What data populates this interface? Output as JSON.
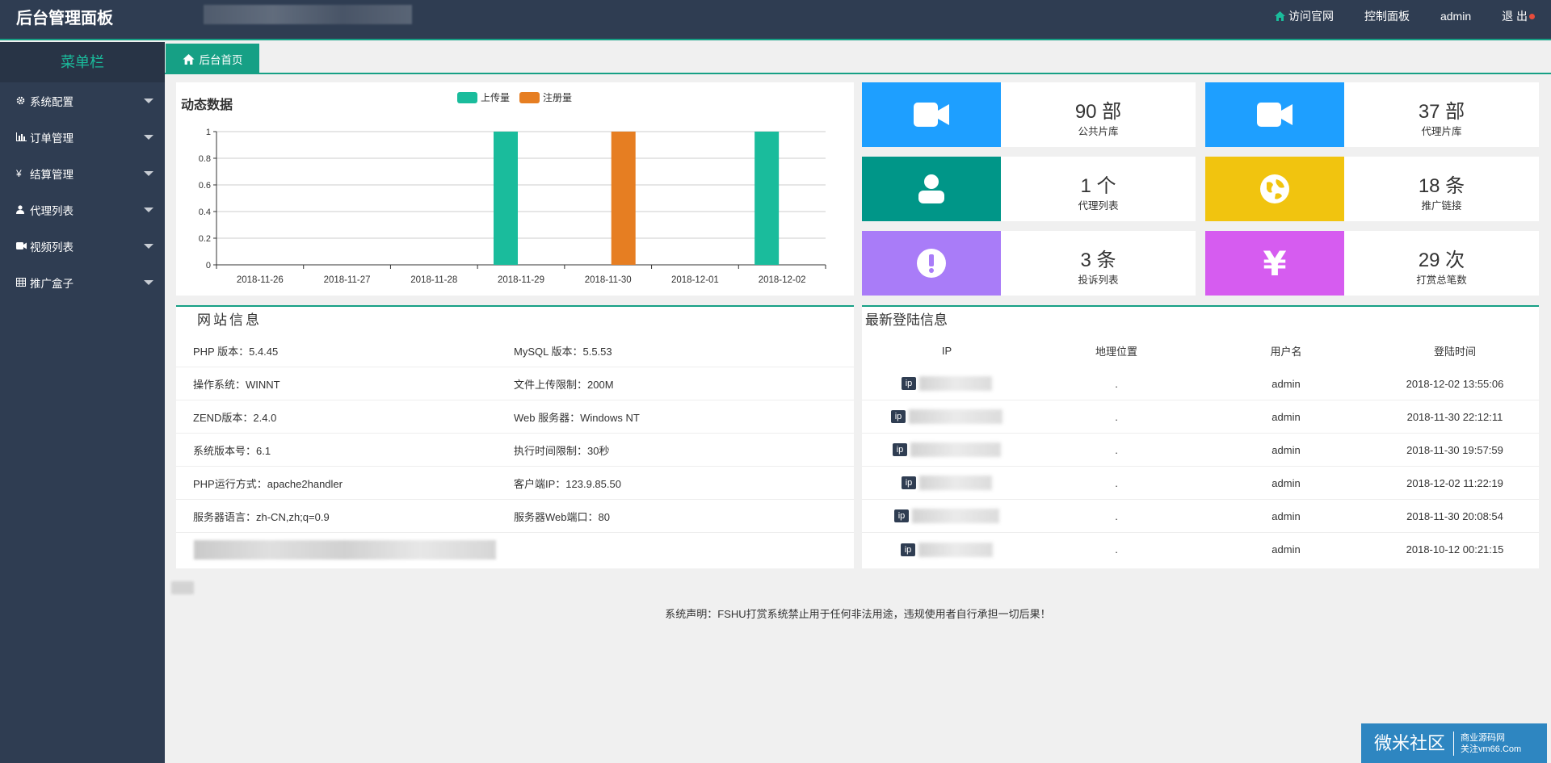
{
  "header": {
    "brand": "后台管理面板",
    "nav": [
      {
        "label": "访问官网",
        "icon": "home-icon"
      },
      {
        "label": "控制面板"
      },
      {
        "label": "admin"
      },
      {
        "label": "退 出"
      }
    ]
  },
  "sidebar": {
    "title": "菜单栏",
    "items": [
      {
        "label": "系统配置",
        "icon": "gear-icon"
      },
      {
        "label": "订单管理",
        "icon": "bar-chart-icon"
      },
      {
        "label": "结算管理",
        "icon": "yen-icon"
      },
      {
        "label": "代理列表",
        "icon": "user-icon"
      },
      {
        "label": "视频列表",
        "icon": "video-icon"
      },
      {
        "label": "推广盒子",
        "icon": "grid-icon"
      }
    ]
  },
  "tabs": [
    {
      "label": "后台首页",
      "icon": "home-icon"
    }
  ],
  "chart_panel": {
    "title": "动态数据"
  },
  "chart_data": {
    "type": "bar",
    "categories": [
      "2018-11-26",
      "2018-11-27",
      "2018-11-28",
      "2018-11-29",
      "2018-11-30",
      "2018-12-01",
      "2018-12-02"
    ],
    "series": [
      {
        "name": "上传量",
        "values": [
          0,
          0,
          0,
          1,
          0,
          0,
          1
        ],
        "color": "#1abc9c"
      },
      {
        "name": "注册量",
        "values": [
          0,
          0,
          0,
          0,
          1,
          0,
          0
        ],
        "color": "#e67e22"
      }
    ],
    "yticks": [
      "0",
      "0.2",
      "0.4",
      "0.6",
      "0.8",
      "1"
    ],
    "ylim": [
      0,
      1
    ],
    "grid": true,
    "legend_position": "top-center"
  },
  "stats": [
    {
      "value": "90 部",
      "caption": "公共片库",
      "color": "#1e9fff",
      "icon": "video-camera-icon"
    },
    {
      "value": "37 部",
      "caption": "代理片库",
      "color": "#1e9fff",
      "icon": "video-camera-icon"
    },
    {
      "value": "1 个",
      "caption": "代理列表",
      "color": "#009688",
      "icon": "user-icon"
    },
    {
      "value": "18 条",
      "caption": "推广链接",
      "color": "#f1c40f",
      "icon": "globe-icon"
    },
    {
      "value": "3 条",
      "caption": "投诉列表",
      "color": "#a97cf8",
      "icon": "exclamation-icon"
    },
    {
      "value": "29 次",
      "caption": "打赏总笔数",
      "color": "#d65cf0",
      "icon": "yen-icon"
    }
  ],
  "site_info": {
    "title": "网站信息",
    "rows": [
      [
        "PHP 版本：5.4.45",
        "MySQL 版本：5.5.53"
      ],
      [
        "操作系统：WINNT",
        "文件上传限制：200M"
      ],
      [
        "ZEND版本：2.4.0",
        "Web 服务器：Windows NT"
      ],
      [
        "系统版本号：6.1",
        "执行时间限制：30秒"
      ],
      [
        "PHP运行方式：apache2handler",
        "客户端IP：123.9.85.50"
      ],
      [
        "服务器语言：zh-CN,zh;q=0.9",
        "服务器Web端口：80"
      ]
    ]
  },
  "login_info": {
    "title": "最新登陆信息",
    "headers": [
      "IP",
      "地理位置",
      "用户名",
      "登陆时间"
    ],
    "badge": "ip",
    "rows": [
      {
        "geo": ".",
        "user": "admin",
        "time": "2018-12-02 13:55:06"
      },
      {
        "geo": ".",
        "user": "admin",
        "time": "2018-11-30 22:12:11"
      },
      {
        "geo": ".",
        "user": "admin",
        "time": "2018-11-30 19:57:59"
      },
      {
        "geo": ".",
        "user": "admin",
        "time": "2018-12-02 11:22:19"
      },
      {
        "geo": ".",
        "user": "admin",
        "time": "2018-11-30 20:08:54"
      },
      {
        "geo": ".",
        "user": "admin",
        "time": "2018-10-12 00:21:15"
      }
    ]
  },
  "footer": {
    "text": "系统声明：FSHU打赏系统禁止用于任何非法用途，违规使用者自行承担一切后果！"
  },
  "watermark": {
    "big": "微米社区",
    "line1": "商业源码网",
    "line2": "关注vm66.Com"
  }
}
